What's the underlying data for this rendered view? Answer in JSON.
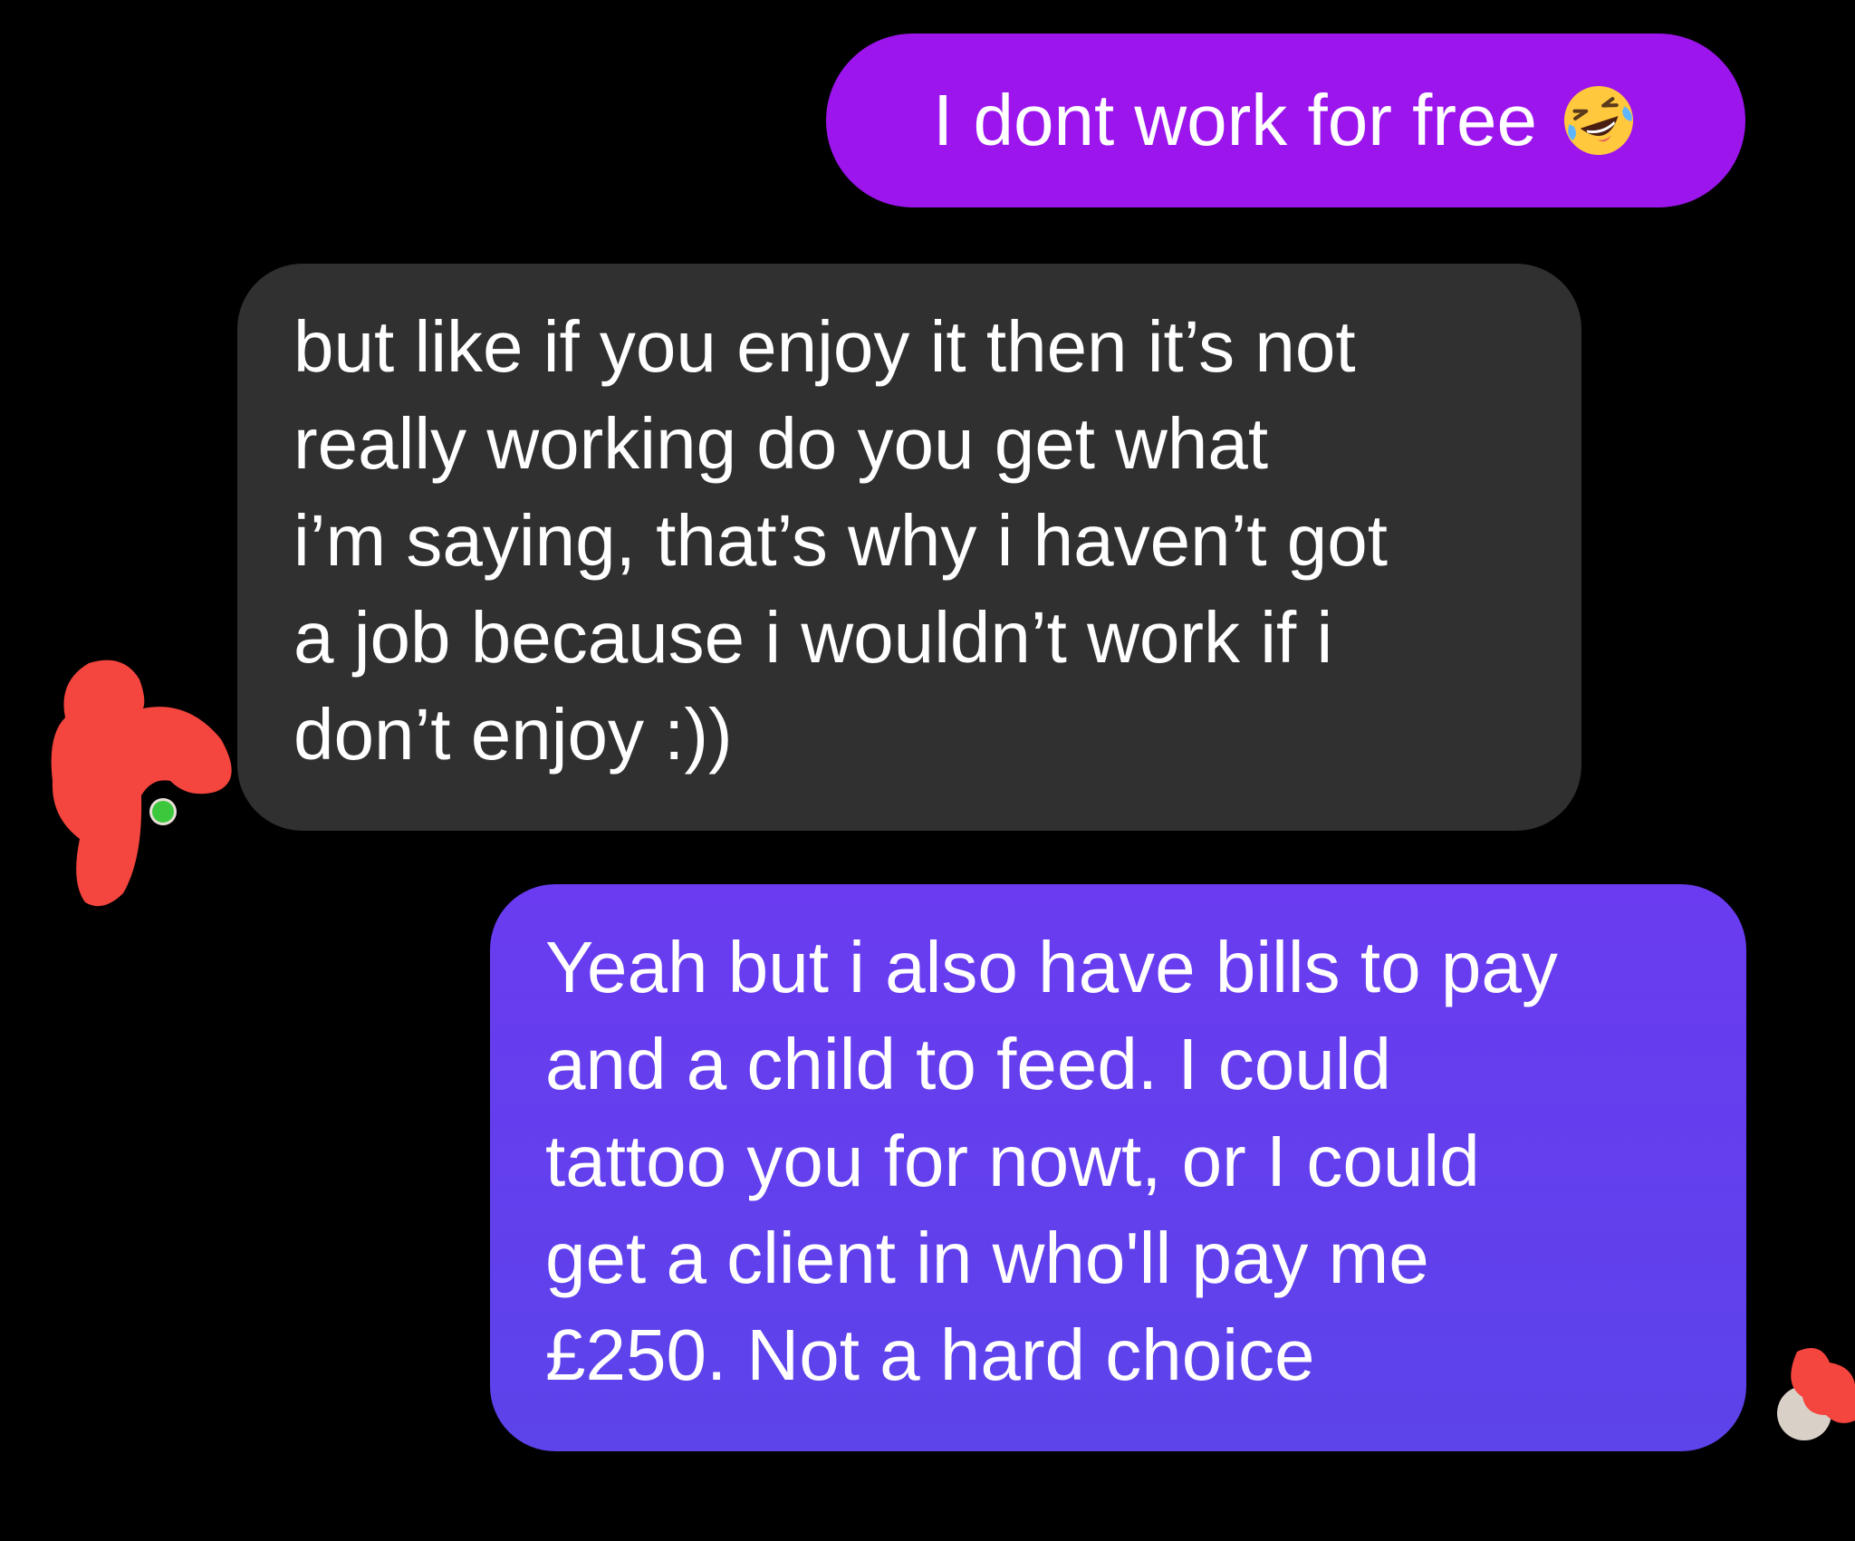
{
  "conversation": {
    "messages": [
      {
        "sender": "me",
        "lines": [
          "I dont work for free"
        ],
        "emoji": "face-with-tears-of-joy-icon"
      },
      {
        "sender": "other",
        "lines": [
          "but like if you enjoy it then it’s not",
          "really working do you get what",
          "i’m saying, that’s why i haven’t got",
          "a job because i wouldn’t work if i",
          "don’t enjoy :))"
        ]
      },
      {
        "sender": "me",
        "lines": [
          "Yeah but i also have bills to pay",
          "and a child to feed. I could",
          "tattoo you for nowt, or I could",
          "get a client in who'll pay me",
          "£250. Not a hard choice"
        ]
      }
    ]
  },
  "colors": {
    "background": "#000000",
    "sent_bubble_top": "#9b15ec",
    "sent_bubble_gradient": [
      "#6a3bf0",
      "#5c43ea"
    ],
    "received_bubble": "#303030",
    "text": "#ffffff",
    "redaction": "#f4453e",
    "online_dot": "#3cc83c"
  }
}
